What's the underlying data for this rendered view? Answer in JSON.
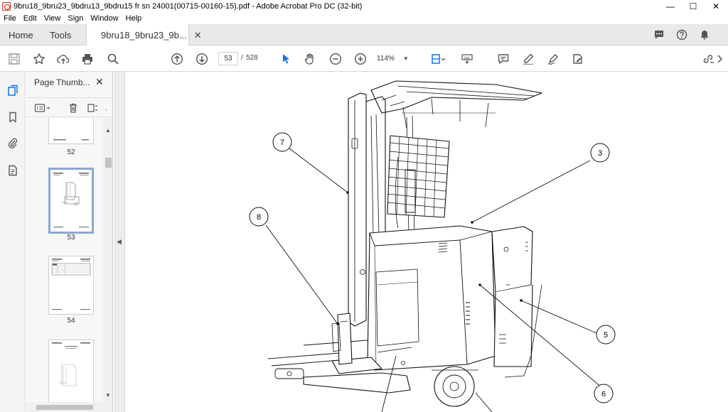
{
  "window": {
    "title": "9bru18_9bru23_9bdru13_9bdru15 fr sn 24001(00715-00160-15).pdf - Adobe Acrobat Pro DC (32-bit)",
    "minimize": "—",
    "maximize": "☐",
    "close": "✕"
  },
  "menu": {
    "items": [
      "File",
      "Edit",
      "View",
      "Sign",
      "Window",
      "Help"
    ]
  },
  "tabs": {
    "home": "Home",
    "tools": "Tools",
    "document": "9bru18_9bru23_9b...",
    "close": "✕"
  },
  "toolbar": {
    "current_page": "53",
    "page_separator": "/",
    "total_pages": "528",
    "zoom": "114%"
  },
  "panel": {
    "title": "Page Thumb...",
    "close": "✕",
    "thumbnails": [
      {
        "label": "52",
        "selected": false
      },
      {
        "label": "53",
        "selected": true
      },
      {
        "label": "54",
        "selected": false
      },
      {
        "label": "",
        "selected": false
      }
    ]
  },
  "document": {
    "callouts": [
      "7",
      "3",
      "8",
      "5",
      "6"
    ]
  },
  "colors": {
    "accent_blue": "#1473e6",
    "selected_thumb_border": "#86a9d6",
    "acrobat_red": "#d62a1e"
  }
}
